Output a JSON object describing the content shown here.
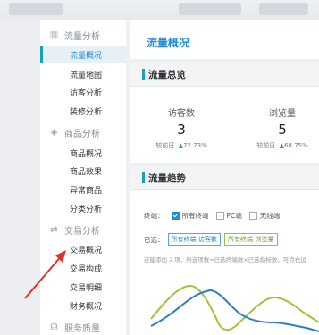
{
  "sidebar": {
    "sections": [
      {
        "title": "流量分析",
        "icon": "bar-chart-icon",
        "items": [
          "流量概况",
          "流量地图",
          "访客分析",
          "装修分析"
        ]
      },
      {
        "title": "商品分析",
        "icon": "cube-icon",
        "items": [
          "商品概况",
          "商品效果",
          "异常商品",
          "分类分析"
        ]
      },
      {
        "title": "交易分析",
        "icon": "exchange-icon",
        "items": [
          "交易概况",
          "交易构成",
          "交易明细",
          "财务概况"
        ]
      },
      {
        "title": "服务质量",
        "icon": "headset-icon",
        "items": []
      }
    ],
    "active_item": "流量概况"
  },
  "main": {
    "page_title": "流量概况",
    "overview": {
      "title": "流量总览",
      "metrics": [
        {
          "label": "访客数",
          "value": "3",
          "compare_label": "较前日",
          "change": "72.73%"
        },
        {
          "label": "浏览量",
          "value": "5",
          "compare_label": "较前日",
          "change": "68.75%"
        }
      ]
    },
    "trend": {
      "title": "流量趋势",
      "terminal_label": "终端：",
      "terminals": [
        {
          "label": "所有终端",
          "checked": true
        },
        {
          "label": "PC端",
          "checked": false
        },
        {
          "label": "无线端",
          "checked": false
        }
      ],
      "selected_label": "已选：",
      "selected_tags": [
        "所有终端-访客数",
        "所有终端-浏览量"
      ],
      "hint_prefix": "还能添加",
      "hint_count": "2",
      "hint_suffix": "项，所选项数=已选终端数×已选指标数，可点右边"
    },
    "colors": {
      "accent": "#1f8ed3",
      "teal": "#17a2b8",
      "line_blue": "#2a7fc4",
      "line_green": "#9fc43a"
    }
  }
}
